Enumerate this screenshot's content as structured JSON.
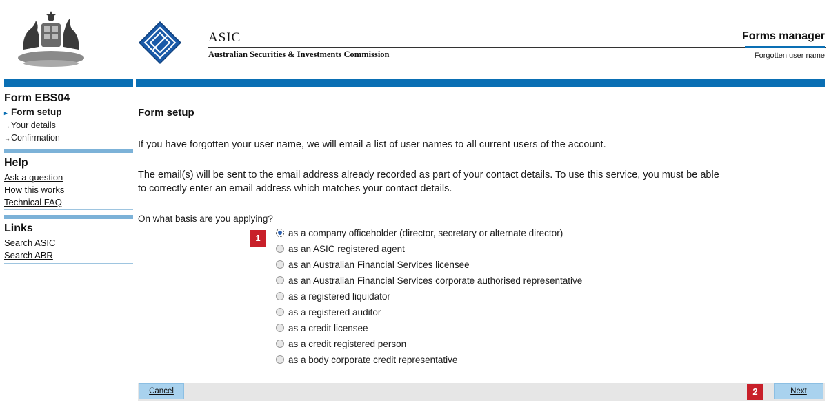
{
  "header": {
    "org_short": "ASIC",
    "org_full": "Australian Securities & Investments Commission",
    "app_title": "Forms manager",
    "app_subtitle": "Forgotten user name"
  },
  "sidebar": {
    "form_title": "Form EBS04",
    "steps": [
      "Form setup",
      "Your details",
      "Confirmation"
    ],
    "help_title": "Help",
    "help_links": [
      "Ask a question",
      "How this works",
      "Technical FAQ"
    ],
    "links_title": "Links",
    "links": [
      "Search ASIC",
      "Search ABR"
    ]
  },
  "main": {
    "heading": "Form setup",
    "para1": "If you have forgotten your user name, we will email a list of user names to all current users of the account.",
    "para2_line1": "The email(s) will be sent to the email address already recorded as part of your contact details. To use this service, you must be able",
    "para2_line2": "to correctly enter an email address which matches your contact details.",
    "question": "On what basis are you applying?",
    "options": [
      "as a company officeholder (director, secretary or alternate director)",
      "as an ASIC registered agent",
      "as an Australian Financial Services licensee",
      "as an Australian Financial Services corporate authorised representative",
      "as a registered liquidator",
      "as a registered auditor",
      "as a credit licensee",
      "as a credit registered person",
      "as a body corporate credit representative"
    ],
    "selected_index": 0,
    "marker1": "1",
    "marker2": "2"
  },
  "footer": {
    "cancel_label": "Cancel",
    "next_label": "Next"
  },
  "colors": {
    "brand_blue": "#0a6fb4",
    "marker_red": "#c8202a",
    "button_blue": "#a9d2ee"
  }
}
